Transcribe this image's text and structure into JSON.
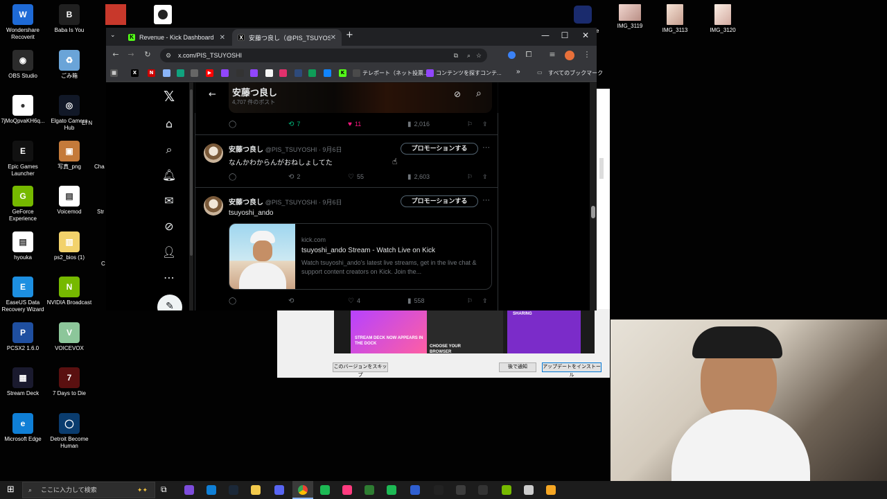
{
  "desktop": {
    "icons": [
      {
        "label": "Wondershare Recoverit",
        "color": "#1e6ad6",
        "glyph": "W"
      },
      {
        "label": "Baba Is You",
        "color": "#202020",
        "glyph": "B"
      },
      {
        "label": "OBS Studio",
        "color": "#2b2b2b",
        "glyph": "◉"
      },
      {
        "label": "ごみ箱",
        "color": "#6aa4d8",
        "glyph": "♻"
      },
      {
        "label": "7jMoQpvaKH6q...",
        "color": "#ffffff",
        "glyph": "●"
      },
      {
        "label": "Elgato Camera Hub",
        "color": "#111827",
        "glyph": "◎"
      },
      {
        "label": "Epic Games Launcher",
        "color": "#111111",
        "glyph": "E"
      },
      {
        "label": "写真_png",
        "color": "#c47a3a",
        "glyph": "▣"
      },
      {
        "label": "GeForce Experience",
        "color": "#76b900",
        "glyph": "G"
      },
      {
        "label": "Voicemod",
        "color": "#ffffff",
        "glyph": "▤"
      },
      {
        "label": "hyouka",
        "color": "#ffffff",
        "glyph": "▤"
      },
      {
        "label": "ps2_bios (1)",
        "color": "#f2d26b",
        "glyph": "▥"
      },
      {
        "label": "EaseUS Data Recovery Wizard",
        "color": "#1d8fe1",
        "glyph": "E"
      },
      {
        "label": "NVIDIA Broadcast",
        "color": "#76b900",
        "glyph": "N"
      },
      {
        "label": "PCSX2 1.6.0",
        "color": "#1f4fa0",
        "glyph": "P"
      },
      {
        "label": "VOICEVOX",
        "color": "#8cc69a",
        "glyph": "V"
      },
      {
        "label": "Stream Deck",
        "color": "#1a1a2e",
        "glyph": "▦"
      },
      {
        "label": "7 Days to Die",
        "color": "#5a1010",
        "glyph": "7"
      },
      {
        "label": "Microsoft Edge",
        "color": "#0f7fd6",
        "glyph": "e"
      },
      {
        "label": "Detroit Become Human",
        "color": "#0a3c6e",
        "glyph": "◯"
      }
    ],
    "partial_labels": [
      "El N",
      "Cha",
      "Str",
      "C"
    ],
    "right_icons": [
      {
        "label": "IMG_3119"
      },
      {
        "label": "IMG_3113"
      },
      {
        "label": "IMG_3120"
      }
    ],
    "right_partial": "ve"
  },
  "browser": {
    "tabs": [
      {
        "title": "Revenue - Kick Dashboard",
        "fav": "K",
        "fav_color": "#53fc18"
      },
      {
        "title": "安藤つ良し（@PIS_TSUYOSHI）",
        "fav": "X",
        "fav_color": "#000000"
      }
    ],
    "new_tab": "+",
    "url": "x.com/PIS_TSUYOSHI",
    "bookmarks": [
      {
        "label": "テレポート（ネット投票..."
      },
      {
        "label": "コンテンツを探すコンテ..."
      }
    ],
    "bookmarks_all": "すべてのブックマーク",
    "bookmarks_more": "»"
  },
  "x": {
    "profile_name": "安藤つ良し",
    "post_count": "4,707 件のポスト",
    "prev_post": {
      "reposts": "7",
      "likes": "11",
      "views": "2,016"
    },
    "posts": [
      {
        "name": "安藤つ良し",
        "handle": "@PIS_TSUYOSHI · 9月6日",
        "text": "なんかわからんがおねしょしてた",
        "promo": "プロモーションする",
        "reposts": "2",
        "likes": "55",
        "views": "2,603"
      },
      {
        "name": "安藤つ良し",
        "handle": "@PIS_TSUYOSHI · 9月6日",
        "text": "tsuyoshi_ando",
        "promo": "プロモーションする",
        "reposts": "",
        "likes": "4",
        "views": "558",
        "card": {
          "domain": "kick.com",
          "title": "tsuyoshi_ando Stream - Watch Live on Kick",
          "desc": "Watch tsuyoshi_ando's latest live streams, get in the live chat & support content creators on Kick. Join the..."
        }
      }
    ]
  },
  "update_dialog": {
    "banner_texts": [
      "STREAM DECK NOW APPEARS IN THE DOCK",
      "CHOOSE YOUR BROWSER",
      "SHARING"
    ],
    "skip": "このバージョンをスキップ",
    "later": "後で通知",
    "install": "アップデートをインストール"
  },
  "taskbar": {
    "search_placeholder": "ここに入力して検索"
  }
}
